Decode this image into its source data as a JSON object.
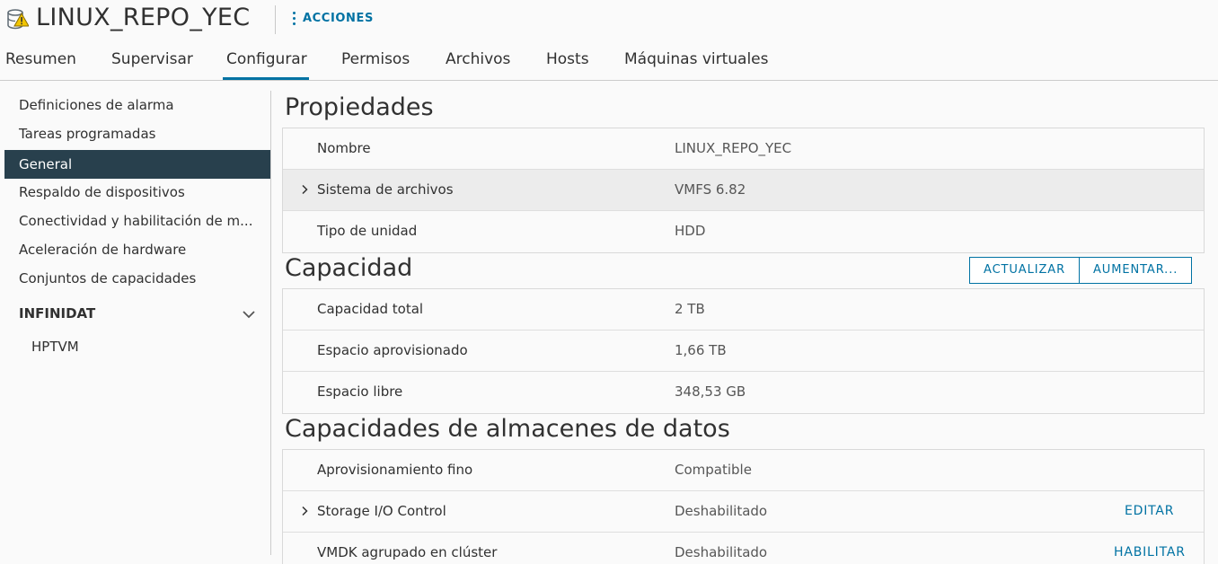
{
  "header": {
    "title": "LINUX_REPO_YEC",
    "icon": "datastore-warning-icon",
    "actions_label": "ACCIONES"
  },
  "tabs": [
    {
      "label": "Resumen"
    },
    {
      "label": "Supervisar"
    },
    {
      "label": "Configurar",
      "active": true
    },
    {
      "label": "Permisos"
    },
    {
      "label": "Archivos"
    },
    {
      "label": "Hosts"
    },
    {
      "label": "Máquinas virtuales"
    }
  ],
  "sidebar": {
    "items": [
      {
        "label": "Definiciones de alarma"
      },
      {
        "label": "Tareas programadas"
      },
      {
        "label": "General",
        "active": true
      },
      {
        "label": "Respaldo de dispositivos"
      },
      {
        "label": "Conectividad y habilitación de m..."
      },
      {
        "label": "Aceleración de hardware"
      },
      {
        "label": "Conjuntos de capacidades"
      }
    ],
    "group": {
      "label": "INFINIDAT",
      "children": [
        {
          "label": "HPTVM"
        }
      ]
    }
  },
  "propiedades": {
    "title": "Propiedades",
    "rows": [
      {
        "key": "Nombre",
        "value": "LINUX_REPO_YEC"
      },
      {
        "key": "Sistema de archivos",
        "value": "VMFS 6.82"
      },
      {
        "key": "Tipo de unidad",
        "value": "HDD"
      }
    ]
  },
  "capacidad": {
    "title": "Capacidad",
    "buttons": {
      "refresh": "ACTUALIZAR",
      "increase": "AUMENTAR..."
    },
    "rows": [
      {
        "key": "Capacidad total",
        "value": "2 TB"
      },
      {
        "key": "Espacio aprovisionado",
        "value": "1,66 TB"
      },
      {
        "key": "Espacio libre",
        "value": "348,53 GB"
      }
    ]
  },
  "capacidades": {
    "title": "Capacidades de almacenes de datos",
    "rows": [
      {
        "key": "Aprovisionamiento fino",
        "value": "Compatible"
      },
      {
        "key": "Storage I/O Control",
        "value": "Deshabilitado",
        "action": "EDITAR"
      },
      {
        "key": "VMDK agrupado en clúster",
        "value": "Deshabilitado",
        "action": "HABILITAR"
      }
    ]
  },
  "colors": {
    "accent": "#0072a3",
    "active_nav": "#28404d",
    "warning": "#f2c500"
  }
}
